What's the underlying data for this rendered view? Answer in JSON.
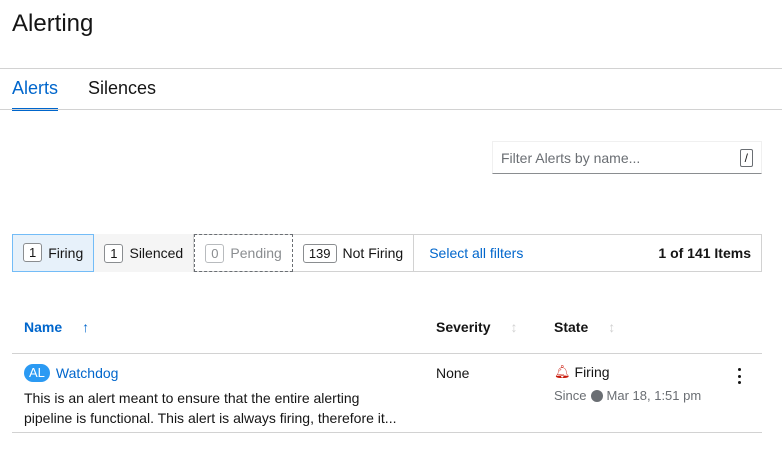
{
  "page": {
    "title": "Alerting"
  },
  "tabs": [
    {
      "label": "Alerts",
      "active": true
    },
    {
      "label": "Silences",
      "active": false
    }
  ],
  "filter": {
    "placeholder": "Filter Alerts by name...",
    "shortcut": "/"
  },
  "filter_chips": [
    {
      "count": "1",
      "label": "Firing"
    },
    {
      "count": "1",
      "label": "Silenced"
    },
    {
      "count": "0",
      "label": "Pending"
    },
    {
      "count": "139",
      "label": "Not Firing"
    }
  ],
  "select_all_label": "Select all filters",
  "items_count": "1 of 141 Items",
  "table": {
    "headers": {
      "name": "Name",
      "severity": "Severity",
      "state": "State"
    },
    "rows": [
      {
        "badge": "AL",
        "name": "Watchdog",
        "description": "This is an alert meant to ensure that the entire alerting pipeline is functional. This alert is always firing, therefore it...",
        "severity": "None",
        "state": "Firing",
        "since_label": "Since",
        "since_time": "Mar 18, 1:51 pm"
      }
    ]
  },
  "colors": {
    "accent": "#0066cc",
    "firing": "#c9190b",
    "badge": "#2b9af3"
  },
  "icons": {
    "sort_name": "arrow-up-icon",
    "sort_other": "sort-icon",
    "state": "bell-icon",
    "since": "globe-icon",
    "row_menu": "kebab-icon"
  }
}
